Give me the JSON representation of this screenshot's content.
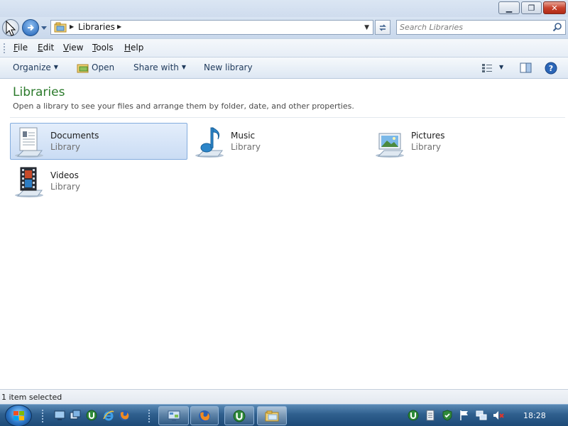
{
  "address": {
    "crumb": "Libraries",
    "search_placeholder": "Search Libraries"
  },
  "menu": [
    "File",
    "Edit",
    "View",
    "Tools",
    "Help"
  ],
  "commands": {
    "organize": "Organize",
    "open": "Open",
    "share_with": "Share with",
    "new_library": "New library"
  },
  "content": {
    "heading": "Libraries",
    "subheading": "Open a library to see your files and arrange them by folder, date, and other properties.",
    "libraries": [
      {
        "name": "Documents",
        "type": "Library",
        "icon": "documents-library-icon",
        "selected": true
      },
      {
        "name": "Music",
        "type": "Library",
        "icon": "music-library-icon",
        "selected": false
      },
      {
        "name": "Pictures",
        "type": "Library",
        "icon": "pictures-library-icon",
        "selected": false
      },
      {
        "name": "Videos",
        "type": "Library",
        "icon": "videos-library-icon",
        "selected": false
      }
    ]
  },
  "status": "1 item selected",
  "taskbar": {
    "clock": "18:28",
    "quick_launch": [
      "show-desktop-icon",
      "switch-windows-icon",
      "utorrent-icon",
      "internet-explorer-icon",
      "firefox-icon"
    ],
    "buttons": [
      "control-panel-icon",
      "firefox-icon",
      "utorrent-icon",
      "windows-explorer-icon"
    ],
    "tray": [
      "utorrent-icon",
      "document-icon",
      "security-shield-icon",
      "action-center-flag-icon",
      "network-icon",
      "volume-muted-icon"
    ]
  },
  "colors": {
    "heading": "#2b7a2b",
    "selection_border": "#83acdd",
    "taskbar": "#2f5f8e"
  }
}
